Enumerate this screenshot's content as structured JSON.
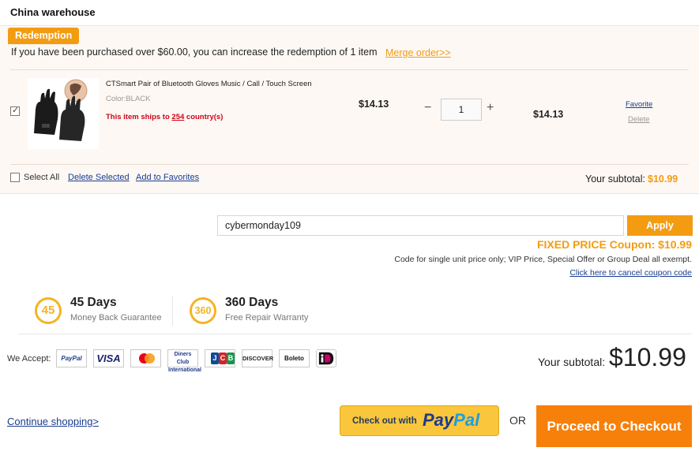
{
  "warehouse": {
    "title": "China warehouse"
  },
  "redemption": {
    "badge": "Redemption",
    "message": "If you have been purchased over $60.00, you can increase the redemption of 1 item",
    "merge_link": "Merge order>>"
  },
  "item": {
    "name": "CTSmart Pair of Bluetooth Gloves Music / Call / Touch Screen",
    "color": "Color:BLACK",
    "ship_prefix": "This item ships to",
    "ship_count": "254",
    "ship_suffix": "country(s)",
    "unit_price": "$14.13",
    "quantity": "1",
    "minus": "−",
    "plus": "+",
    "line_total": "$14.13",
    "favorite": "Favorite",
    "delete": "Delete",
    "checked": true,
    "image_icon": "gloves-product-image"
  },
  "bulk": {
    "select_all": "Select All",
    "delete_selected": "Delete Selected",
    "add_favorites": "Add to Favorites",
    "subtotal_label": "Your subtotal:",
    "subtotal_value": "$10.99"
  },
  "coupon": {
    "code": "cybermonday109",
    "apply": "Apply",
    "title": "FIXED PRICE Coupon: $10.99",
    "note": "Code for single unit price only; VIP Price, Special Offer or Group Deal all exempt.",
    "cancel": "Click here to cancel coupon code"
  },
  "guarantees": [
    {
      "badge": "45",
      "title": "45 Days",
      "subtitle": "Money Back Guarantee"
    },
    {
      "badge": "360",
      "title": "360 Days",
      "subtitle": "Free Repair Warranty"
    }
  ],
  "payment": {
    "label": "We Accept:",
    "methods": [
      "PayPal",
      "VISA",
      "Mastercard",
      "Diners Club International",
      "JCB",
      "DISCOVER",
      "Boleto",
      "iDEAL"
    ]
  },
  "summary": {
    "subtotal_label": "Your subtotal:",
    "subtotal_value": "$10.99"
  },
  "actions": {
    "continue": "Continue shopping>",
    "paypal_prefix": "Check out with",
    "paypal_logo_a": "Pay",
    "paypal_logo_b": "Pal",
    "or": "OR",
    "checkout": "Proceed to Checkout"
  },
  "colors": {
    "accent": "#f39c12",
    "checkout": "#f7800a",
    "link": "#1a3d8f",
    "alert": "#d0021b",
    "paypal": "#f9c63c"
  }
}
